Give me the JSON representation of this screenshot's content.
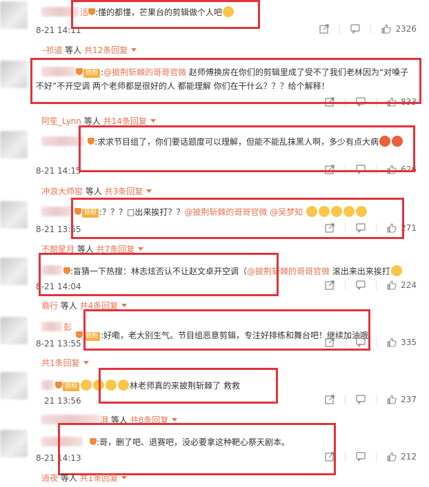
{
  "badge_label": "铁粉",
  "comments": [
    {
      "suffix": "活",
      "text": ":懂的都懂，芒果台的剪辑做个人吧",
      "time": "8-21 14:11",
      "likes": "2326"
    },
    {
      "reply": {
        "user": "-祁道",
        "etc": " 等人 ",
        "count": "共12条回复"
      }
    },
    {
      "mention": "@披荆斩棘的哥哥官微",
      "text_line1": " 赵师傅换房在你们的剪辑里成了受不了我们老林因为“对嗓子",
      "text_line2": "不好”不开空调 两个老师都是很好的人 都能理解 你们在干什么？？？给个解释！",
      "likes": "833"
    },
    {
      "reply": {
        "user": "阿笙_Lynn",
        "etc": " 等人 ",
        "count": "共14条回复"
      }
    },
    {
      "text": ":求求节目组了，你们要话题度可以理解，但能不能乱抹黑人啊，多少有点大病",
      "time": "8-21 14:15",
      "likes": "626"
    },
    {
      "reply": {
        "user": "冲浪大师窑",
        "etc": " 等人 ",
        "count": "共3条回复"
      }
    },
    {
      "text_pre": ":？？？□出来挨打？？",
      "mention1": "@披荆斩棘的哥哥官微",
      "mention2": "@吴梦知",
      "time": "8-21 13:55",
      "likes": "271"
    },
    {
      "reply": {
        "user": "不期星月",
        "etc": " 等人 ",
        "count": "共7条回复"
      }
    },
    {
      "text_pre": ":盲猜一下热搜：林志炫否认不让赵文卓开空调（",
      "mention": "@披荆斩棘的哥哥官微",
      "text_post": " 滚出来出来挨打",
      "time": "8-21 14:04",
      "likes": "224"
    },
    {
      "reply": {
        "user": "裔行",
        "etc": " 等人 ",
        "count": "共4条回复"
      }
    },
    {
      "suffix": "彭",
      "text": ":好嘞，老大别生气。节目组恶意剪辑，专注好排练和舞台吧！继续加油哦",
      "time": "8-21 13:55",
      "likes": "335"
    },
    {
      "reply": {
        "user": "",
        "etc": "",
        "count": "共1条回复"
      }
    },
    {
      "text": "林老师真的来披荆斩棘了 救救",
      "time": "21 13:56",
      "likes": "237"
    },
    {
      "reply": {
        "user": "湃",
        "etc": " 等人 ",
        "count": "共8条回复"
      }
    },
    {
      "text": ":哥，删了吧、退赛吧，没必要拿这种靶心祭天剧本。",
      "time": "8-21 14:13",
      "likes": "212"
    },
    {
      "reply": {
        "user": "逍夜",
        "etc": " 等人 ",
        "count": "共1条回复"
      }
    }
  ]
}
